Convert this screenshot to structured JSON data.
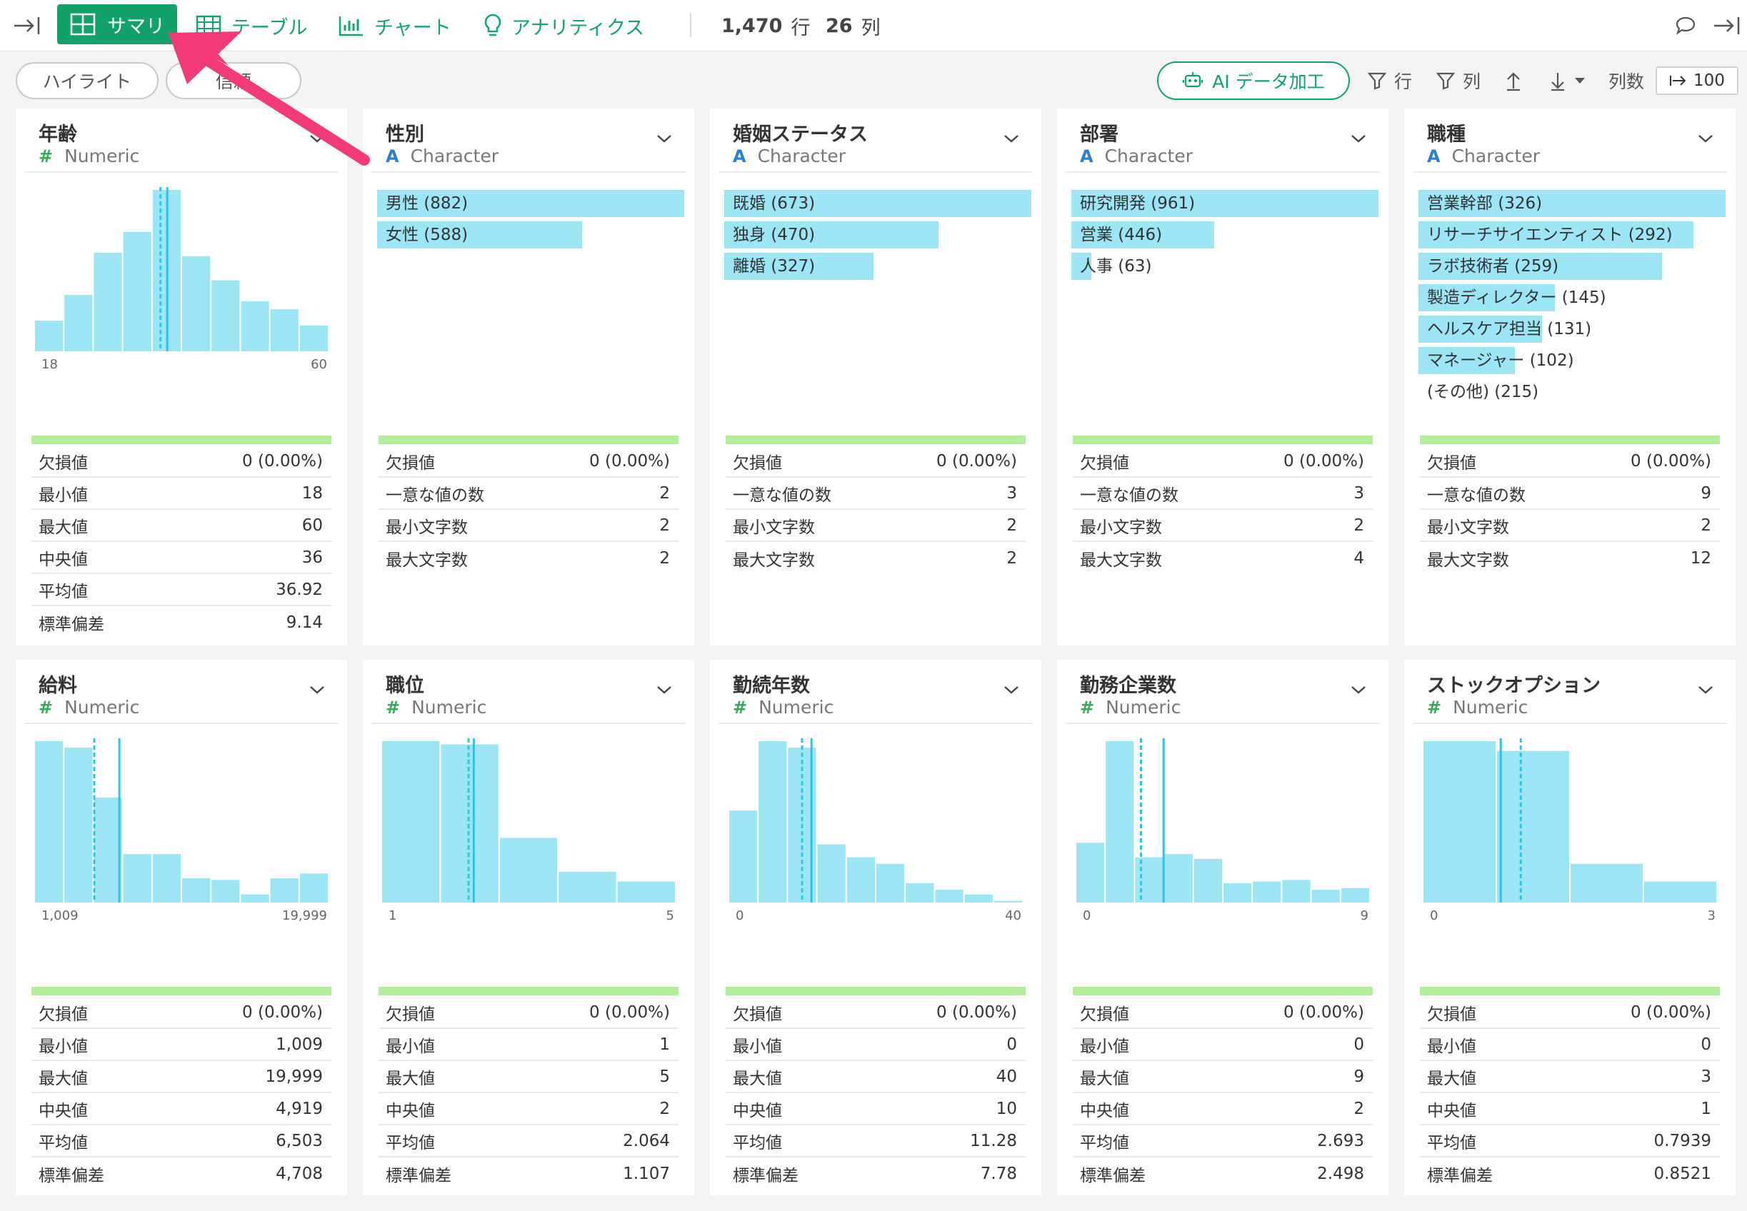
{
  "toolbar": {
    "tabs": [
      {
        "label": "サマリ",
        "active": true
      },
      {
        "label": "テーブル"
      },
      {
        "label": "チャート"
      },
      {
        "label": "アナリティクス"
      }
    ],
    "rows": {
      "value": "1,470",
      "unit": "行"
    },
    "cols": {
      "value": "26",
      "unit": "列"
    }
  },
  "subbar": {
    "highlight_label": "ハイライト",
    "second_pill": "信頼",
    "ai_label": "AI データ加工",
    "filter_row_label": "行",
    "filter_col_label": "列",
    "col_count_label": "列数",
    "col_count_value": "100"
  },
  "colors": {
    "accent": "#13a16a",
    "bar": "#9be5f4",
    "line": "#2fc4e4",
    "ok": "#b3ee9a"
  },
  "num_stat_labels": [
    "欠損値",
    "最小値",
    "最大値",
    "中央値",
    "平均値",
    "標準偏差"
  ],
  "chr_stat_labels": [
    "欠損値",
    "一意な値の数",
    "最小文字数",
    "最大文字数"
  ],
  "cards": [
    {
      "name": "年齢",
      "type": "Numeric",
      "kind": "num",
      "axis_min": "18",
      "axis_max": "60",
      "hist": [
        0.19,
        0.35,
        0.61,
        0.74,
        1.0,
        0.59,
        0.44,
        0.31,
        0.26,
        0.16
      ],
      "mean_pos": 0.452,
      "median_pos": 0.429,
      "stats": [
        "0 (0.00%)",
        "18",
        "60",
        "36",
        "36.92",
        "9.14"
      ]
    },
    {
      "name": "性別",
      "type": "Character",
      "kind": "chr",
      "cats": [
        {
          "label": "男性 (882)",
          "frac": 1.0
        },
        {
          "label": "女性 (588)",
          "frac": 0.667
        }
      ],
      "stats": [
        "0 (0.00%)",
        "2",
        "2",
        "2"
      ]
    },
    {
      "name": "婚姻ステータス",
      "type": "Character",
      "kind": "chr",
      "cats": [
        {
          "label": "既婚 (673)",
          "frac": 1.0
        },
        {
          "label": "独身 (470)",
          "frac": 0.698
        },
        {
          "label": "離婚 (327)",
          "frac": 0.486
        }
      ],
      "stats": [
        "0 (0.00%)",
        "3",
        "2",
        "2"
      ]
    },
    {
      "name": "部署",
      "type": "Character",
      "kind": "chr",
      "cats": [
        {
          "label": "研究開発 (961)",
          "frac": 1.0
        },
        {
          "label": "営業 (446)",
          "frac": 0.464
        },
        {
          "label": "人事 (63)",
          "frac": 0.066
        }
      ],
      "stats": [
        "0 (0.00%)",
        "3",
        "2",
        "4"
      ]
    },
    {
      "name": "職種",
      "type": "Character",
      "kind": "chr",
      "cats": [
        {
          "label": "営業幹部 (326)",
          "frac": 1.0
        },
        {
          "label": "リサーチサイエンティスト (292)",
          "frac": 0.896
        },
        {
          "label": "ラボ技術者 (259)",
          "frac": 0.794
        },
        {
          "label": "製造ディレクター (145)",
          "frac": 0.445
        },
        {
          "label": "ヘルスケア担当 (131)",
          "frac": 0.402
        },
        {
          "label": "マネージャー (102)",
          "frac": 0.313
        },
        {
          "label": "(その他) (215)",
          "frac": 0
        }
      ],
      "stats": [
        "0 (0.00%)",
        "9",
        "2",
        "12"
      ]
    },
    {
      "name": "給料",
      "type": "Numeric",
      "kind": "num",
      "axis_min": "1,009",
      "axis_max": "19,999",
      "hist": [
        1.0,
        0.96,
        0.65,
        0.3,
        0.3,
        0.15,
        0.14,
        0.05,
        0.15,
        0.18
      ],
      "mean_pos": 0.289,
      "median_pos": 0.204,
      "stats": [
        "0 (0.00%)",
        "1,009",
        "19,999",
        "4,919",
        "6,503",
        "4,708"
      ]
    },
    {
      "name": "職位",
      "type": "Numeric",
      "kind": "num",
      "axis_min": "1",
      "axis_max": "5",
      "hist": [
        1.0,
        0.98,
        0.4,
        0.19,
        0.13
      ],
      "mean_pos": 0.314,
      "median_pos": 0.296,
      "stats": [
        "0 (0.00%)",
        "1",
        "5",
        "2",
        "2.064",
        "1.107"
      ]
    },
    {
      "name": "勤続年数",
      "type": "Numeric",
      "kind": "num",
      "axis_min": "0",
      "axis_max": "40",
      "hist": [
        0.57,
        1.0,
        0.96,
        0.36,
        0.28,
        0.24,
        0.12,
        0.08,
        0.05,
        0.01
      ],
      "mean_pos": 0.282,
      "median_pos": 0.25,
      "stats": [
        "0 (0.00%)",
        "0",
        "40",
        "10",
        "11.28",
        "7.78"
      ]
    },
    {
      "name": "勤務企業数",
      "type": "Numeric",
      "kind": "num",
      "axis_min": "0",
      "axis_max": "9",
      "hist": [
        0.37,
        1.0,
        0.28,
        0.3,
        0.27,
        0.12,
        0.13,
        0.14,
        0.08,
        0.09
      ],
      "mean_pos": 0.299,
      "median_pos": 0.222,
      "stats": [
        "0 (0.00%)",
        "0",
        "9",
        "2",
        "2.693",
        "2.498"
      ]
    },
    {
      "name": "ストックオプション",
      "type": "Numeric",
      "kind": "num",
      "axis_min": "0",
      "axis_max": "3",
      "hist": [
        1.0,
        0.94,
        0.24,
        0.13
      ],
      "mean_pos": 0.265,
      "median_pos": 0.333,
      "stats": [
        "0 (0.00%)",
        "0",
        "3",
        "1",
        "0.7939",
        "0.8521"
      ]
    }
  ]
}
